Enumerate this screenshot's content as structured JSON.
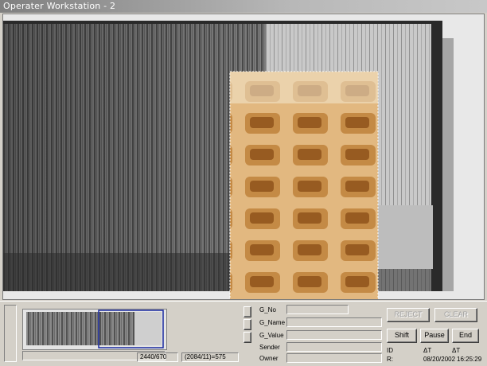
{
  "window": {
    "title": "Operater Workstation - 2"
  },
  "navigator": {
    "coord_left": "2440/670",
    "coord_right": "(2084/11)=575"
  },
  "info": {
    "fields": [
      {
        "key": "g_no",
        "label": "G_No"
      },
      {
        "key": "g_name",
        "label": "G_Name"
      },
      {
        "key": "g_value",
        "label": "G_Value"
      },
      {
        "key": "sender",
        "label": "Sender"
      },
      {
        "key": "owner",
        "label": "Owner"
      }
    ]
  },
  "actions": {
    "reject_label": "REJECT",
    "clear_label": "CLEAR",
    "shift_label": "Shift",
    "pause_label": "Pause",
    "end_label": "End"
  },
  "status": {
    "id_label": "ID",
    "dt_label": "ΔT",
    "dt2_label": "ΔT",
    "date": "08/20/2002",
    "time": "16:25:29",
    "r_label": "R:"
  },
  "colors": {
    "titlebar": "#8a8a8a",
    "panel": "#d4d0c8",
    "highlight": "#c47a20",
    "nav_frame": "#1a2aa0"
  }
}
